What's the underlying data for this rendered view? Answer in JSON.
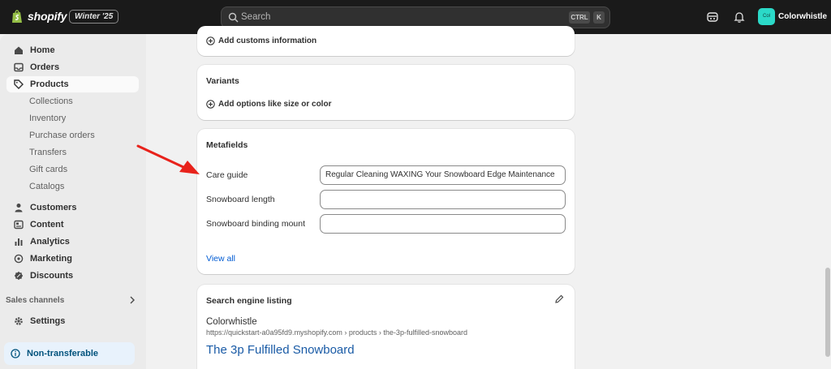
{
  "topbar": {
    "brand": "shopify",
    "season_badge": "Winter '25",
    "search_placeholder": "Search",
    "shortcut_ctrl": "CTRL",
    "shortcut_k": "K",
    "store_avatar": "Col",
    "store_name": "Colorwhistle"
  },
  "sidebar": {
    "items": [
      {
        "label": "Home",
        "icon": "home-icon"
      },
      {
        "label": "Orders",
        "icon": "inbox-icon"
      },
      {
        "label": "Products",
        "icon": "tag-icon",
        "active": true
      }
    ],
    "product_subitems": [
      "Collections",
      "Inventory",
      "Purchase orders",
      "Transfers",
      "Gift cards",
      "Catalogs"
    ],
    "items2": [
      {
        "label": "Customers",
        "icon": "person-icon"
      },
      {
        "label": "Content",
        "icon": "content-icon"
      },
      {
        "label": "Analytics",
        "icon": "chart-bar-icon"
      },
      {
        "label": "Marketing",
        "icon": "target-icon"
      },
      {
        "label": "Discounts",
        "icon": "discount-icon"
      }
    ],
    "sales_channels": "Sales channels",
    "settings": "Settings",
    "non_transferable": "Non-transferable"
  },
  "main": {
    "customs_link": "Add customs information",
    "variants": {
      "title": "Variants",
      "add_link": "Add options like size or color"
    },
    "metafields": {
      "title": "Metafields",
      "fields": [
        {
          "label": "Care guide",
          "value": "Regular Cleaning WAXING Your Snowboard Edge Maintenance"
        },
        {
          "label": "Snowboard length",
          "value": ""
        },
        {
          "label": "Snowboard binding mount",
          "value": ""
        }
      ],
      "view_all": "View all"
    },
    "seo": {
      "title": "Search engine listing",
      "store": "Colorwhistle",
      "url": "https://quickstart-a0a95fd9.myshopify.com › products › the-3p-fulfilled-snowboard",
      "page_title": "The 3p Fulfilled Snowboard"
    }
  },
  "colors": {
    "topbar": "#1a1a1a",
    "link": "#005bd3",
    "arrow": "#e8221b",
    "avatar": "#2bd9c8"
  }
}
